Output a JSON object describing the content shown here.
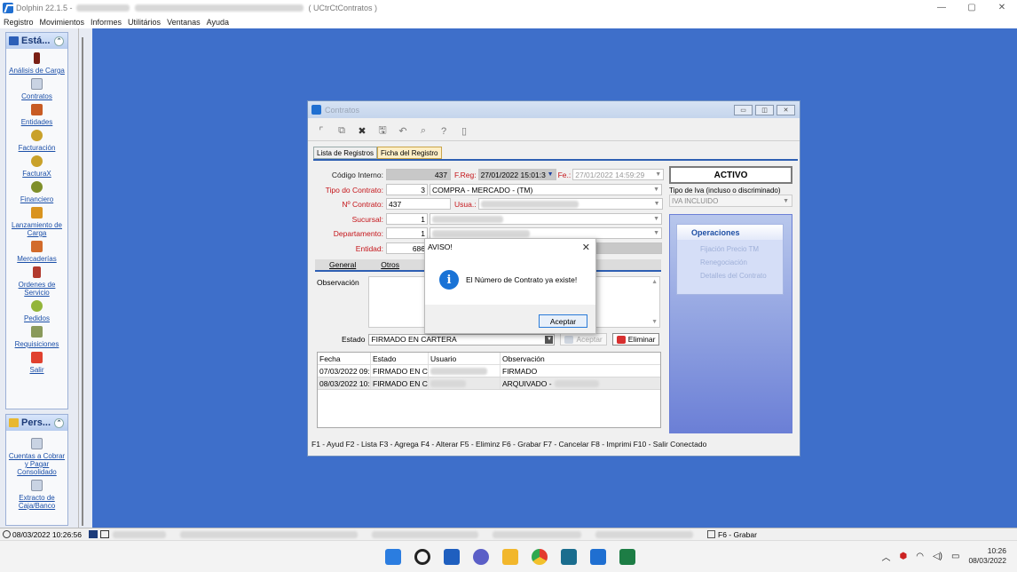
{
  "app": {
    "title": "Dolphin 22.1.5 -",
    "window_subtitle": "( UCtrCtContratos )"
  },
  "menu": [
    "Registro",
    "Movimientos",
    "Informes",
    "Utilitários",
    "Ventanas",
    "Ayuda"
  ],
  "sidebar": {
    "panel1_title": "Está...",
    "panel1_items": [
      {
        "label": "Análisis de Carga",
        "icon": "analysis-icon"
      },
      {
        "label": "Contratos",
        "icon": "contract-icon"
      },
      {
        "label": "Entidades",
        "icon": "entities-icon"
      },
      {
        "label": "Facturación",
        "icon": "billing-icon"
      },
      {
        "label": "FacturaX",
        "icon": "facturax-icon"
      },
      {
        "label": "Financiero",
        "icon": "finance-icon"
      },
      {
        "label": "Lanzamiento de Carga",
        "icon": "truck-icon"
      },
      {
        "label": "Mercaderías",
        "icon": "goods-icon"
      },
      {
        "label": "Ordenes de Servicio",
        "icon": "service-icon"
      },
      {
        "label": "Pedidos",
        "icon": "orders-icon"
      },
      {
        "label": "Requisiciones",
        "icon": "requisitions-icon"
      },
      {
        "label": "Salir",
        "icon": "exit-icon"
      }
    ],
    "panel2_title": "Pers...",
    "panel2_items": [
      {
        "label": "Cuentas a Cobrar y Pagar Consolidado",
        "icon": "accounts-icon"
      },
      {
        "label": "Extracto de Caja/Banco",
        "icon": "statement-icon"
      }
    ]
  },
  "contracts_window": {
    "title": "Contratos",
    "tabs": [
      "Lista de Registros",
      "Ficha del Registro"
    ],
    "fields": {
      "codigo_interno_label": "Código Interno:",
      "codigo_interno_value": "437",
      "freg_label": "F.Reg:",
      "freg_value": "27/01/2022 15:01:3",
      "fe_label": "Fe.:",
      "fe_value": "27/01/2022 14:59:29",
      "tipo_contrato_label": "Tipo do Contrato:",
      "tipo_contrato_code": "3",
      "tipo_contrato_desc": "COMPRA - MERCADO - (TM)",
      "nro_contrato_label": "Nº Contrato:",
      "nro_contrato_value": "437",
      "usua_label": "Usua.:",
      "sucursal_label": "Sucursal:",
      "sucursal_value": "1",
      "departamento_label": "Departamento:",
      "departamento_value": "1",
      "entidad_label": "Entidad:",
      "entidad_value": "686"
    },
    "status": "ACTIVO",
    "iva_label": "Tipo de Iva (incluso o discriminado)",
    "iva_value": "IVA INCLUIDO",
    "operations": {
      "title": "Operaciones",
      "items": [
        "Fijación Precio TM",
        "Renegociación",
        "Detalles del Contrato"
      ]
    },
    "subtabs": [
      "General",
      "Otros"
    ],
    "observacion_label": "Observación",
    "estado_label": "Estado",
    "estado_value": "FIRMADO EN CARTERA",
    "aceptar_label": "Aceptar",
    "eliminar_label": "Eliminar",
    "grid": {
      "headers": [
        "Fecha",
        "Estado",
        "Usuario",
        "Observación"
      ],
      "rows": [
        [
          "07/03/2022 09:",
          "FIRMADO EN CA",
          "",
          "FIRMADO"
        ],
        [
          "08/03/2022 10:",
          "FIRMADO EN CA",
          "",
          "ARQUIVADO -"
        ]
      ]
    },
    "fkeys": "F1 - Ayud  F2 - Lista  F3 - Agrega  F4 - Alterar  F5 - Eliminz  F6 - Grabar  F7 - Cancelar  F8 - Imprimi  F10 - Salir  Conectado"
  },
  "dialog": {
    "title": "AVISO!",
    "message": "El Número de Contrato ya existe!",
    "button": "Aceptar"
  },
  "statusbar": {
    "datetime": "08/03/2022 10:26:56",
    "grabar": "F6 - Grabar"
  },
  "taskbar": {
    "time": "10:26",
    "date": "08/03/2022"
  },
  "colors": {
    "desktop": "#3e6fca",
    "accent": "#1f6fd1",
    "operations": "#6b7fd6"
  }
}
